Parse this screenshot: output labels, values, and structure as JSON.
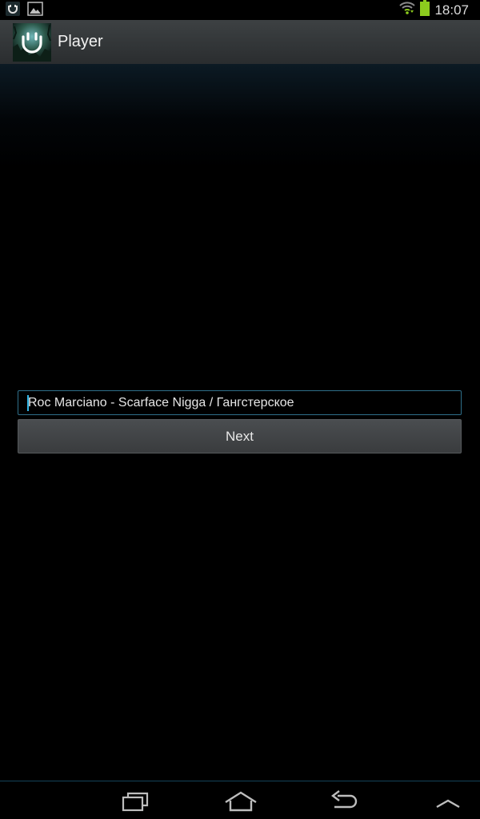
{
  "status_bar": {
    "time": "18:07",
    "icons": [
      "app-notification-icon",
      "image-notification-icon",
      "wifi-icon",
      "battery-icon"
    ],
    "battery_color": "#8ccc1e"
  },
  "action_bar": {
    "title": "Player",
    "icon": "app-logo-icon"
  },
  "main": {
    "track_input_value": "Roc Marciano - Scarface Nigga / Гангстерское",
    "next_label": "Next"
  },
  "nav_bar": {
    "buttons": [
      "recent-apps-icon",
      "home-icon",
      "back-icon",
      "menu-up-icon"
    ]
  },
  "colors": {
    "accent": "#33b5e5",
    "input_border": "#2f6f8a"
  }
}
